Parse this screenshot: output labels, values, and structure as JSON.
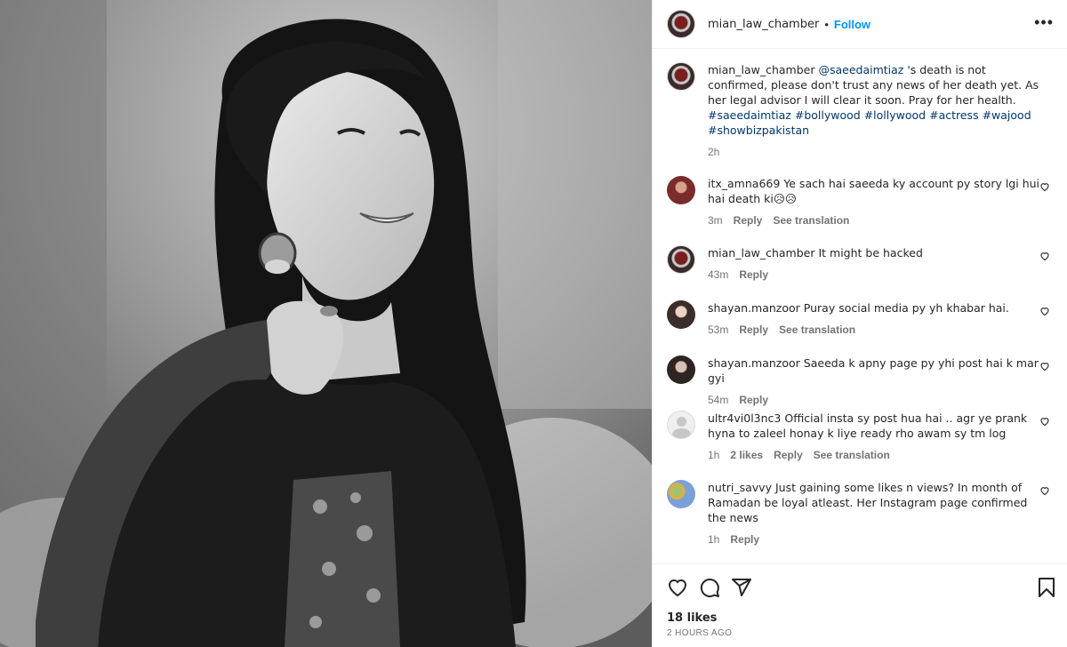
{
  "post": {
    "username": "mian_law_chamber",
    "separator": "•",
    "follow_label": "Follow",
    "more_icon": "more-horizontal-icon"
  },
  "caption": {
    "username": "mian_law_chamber",
    "mention": "@saeedaimtiaz",
    "text": " 's death is not confirmed, please don't trust any news of her death yet. As her legal advisor I will clear it soon. Pray for her health.",
    "hashtags": [
      "#saeedaimtiaz",
      "#bollywood",
      "#lollywood",
      "#actress",
      "#wajood",
      "#showbizpakistan"
    ],
    "time": "2h"
  },
  "comments": [
    {
      "username": "itx_amna669",
      "text": "Ye sach hai saeeda ky account py story lgi hui hai death ki😥😥",
      "time": "3m",
      "reply": "Reply",
      "translate": "See translation",
      "likes": ""
    },
    {
      "username": "mian_law_chamber",
      "text": "It might be hacked",
      "time": "43m",
      "reply": "Reply",
      "translate": "",
      "likes": ""
    },
    {
      "username": "shayan.manzoor",
      "text": "Puray social media py yh khabar hai.",
      "time": "53m",
      "reply": "Reply",
      "translate": "See translation",
      "likes": ""
    },
    {
      "username": "shayan.manzoor",
      "text": "Saeeda k apny page py yhi post hai k mar gyi",
      "time": "54m",
      "reply": "Reply",
      "translate": "",
      "likes": ""
    },
    {
      "username": "ultr4vi0l3nc3",
      "text": "Official insta sy post hua hai .. agr ye prank hyna to zaleel honay k liye ready rho awam sy tm log",
      "time": "1h",
      "reply": "Reply",
      "translate": "See translation",
      "likes": "2 likes"
    },
    {
      "username": "nutri_savvy",
      "text": "Just gaining some likes n views? In month of Ramadan be loyal atleast. Her Instagram page confirmed the news",
      "time": "1h",
      "reply": "Reply",
      "translate": "",
      "likes": ""
    }
  ],
  "footer": {
    "likes": "18 likes",
    "posted": "2 HOURS AGO"
  },
  "colors": {
    "link_blue": "#0095f6",
    "tag_blue": "#00376b",
    "meta_gray": "#737373"
  }
}
